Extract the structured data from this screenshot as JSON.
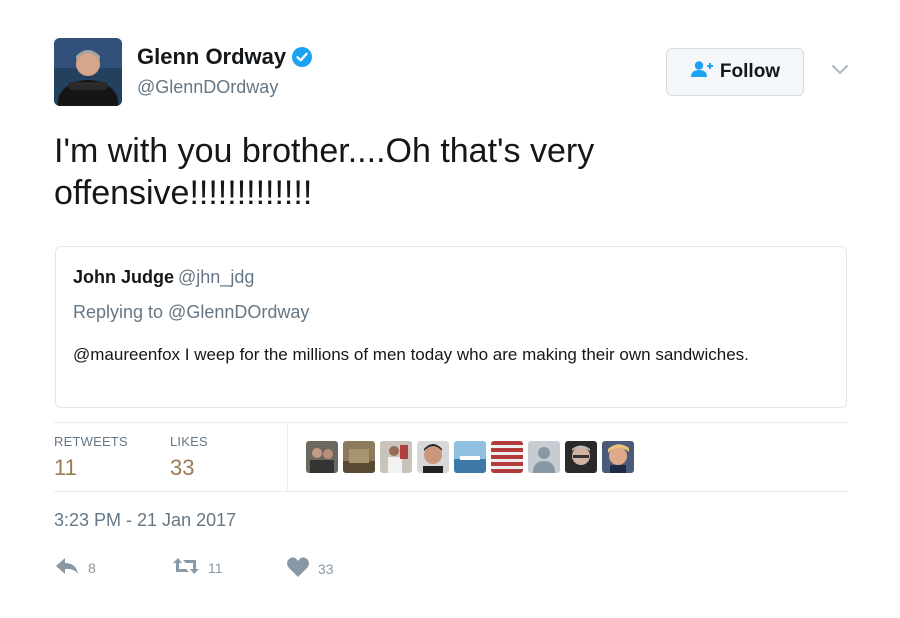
{
  "author": {
    "name": "Glenn Ordway",
    "handle": "@GlennDOrdway",
    "verified": true,
    "avatar_icon": "user-avatar"
  },
  "follow_button": {
    "label": "Follow",
    "icon": "add-user-icon"
  },
  "tweet_text": "I'm with you brother....Oh that's very offensive!!!!!!!!!!!!!",
  "quoted_tweet": {
    "name": "John Judge",
    "handle": "@jhn_jdg",
    "replying_to": "Replying to @GlennDOrdway",
    "text": "@maureenfox I weep for the millions of men today who are making their own sandwiches."
  },
  "stats": {
    "retweets_label": "RETWEETS",
    "retweets_value": "11",
    "likes_label": "LIKES",
    "likes_value": "33"
  },
  "liker_avatars": [
    "liker-avatar-1",
    "liker-avatar-2",
    "liker-avatar-3",
    "liker-avatar-4",
    "liker-avatar-5",
    "liker-avatar-6",
    "liker-avatar-7",
    "liker-avatar-8",
    "liker-avatar-9"
  ],
  "timestamp": "3:23 PM - 21 Jan 2017",
  "actions": {
    "reply_count": "8",
    "retweet_count": "11",
    "like_count": "33"
  },
  "colors": {
    "verified_blue": "#1da1f2",
    "stat_value": "#9c7a52",
    "secondary_text": "#657786",
    "action_gray": "#8899a6"
  }
}
